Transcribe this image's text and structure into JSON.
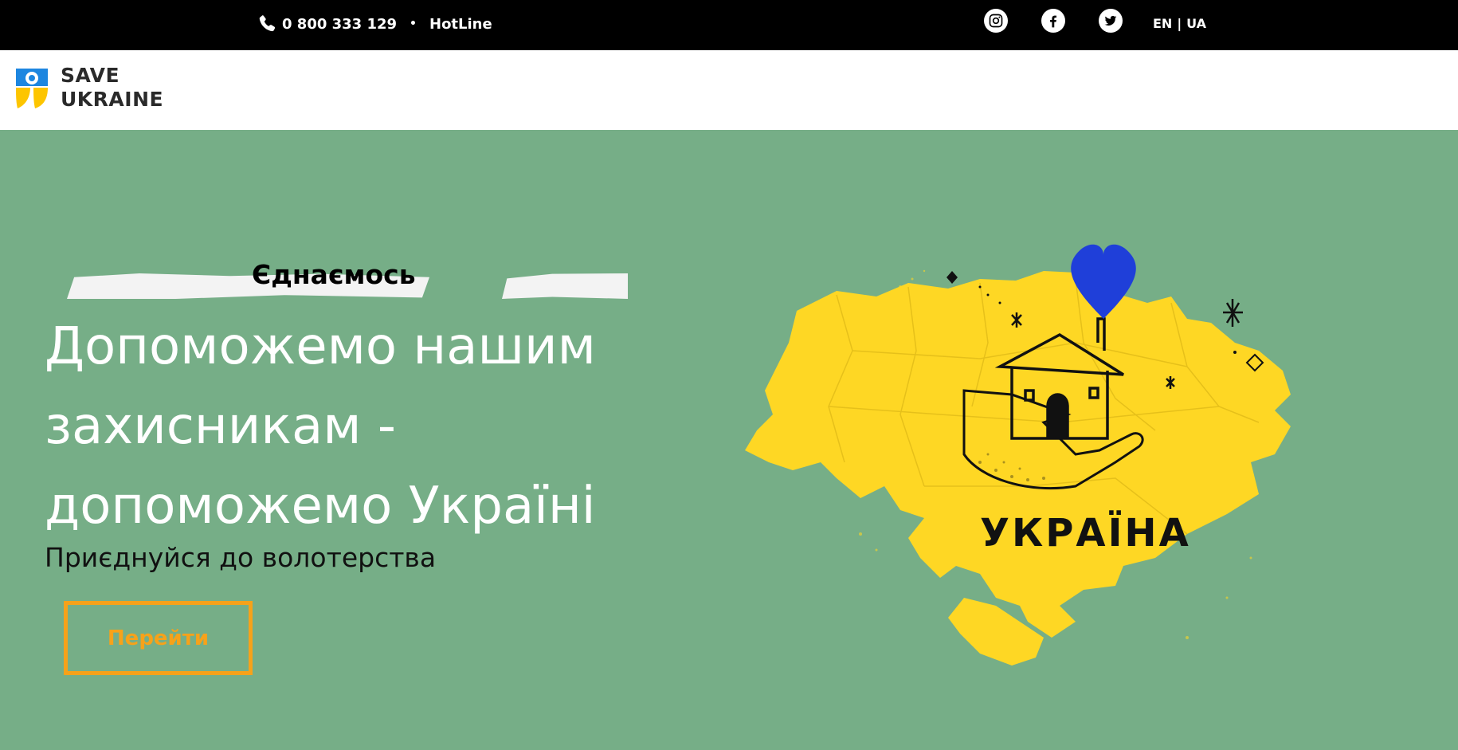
{
  "topbar": {
    "phone_number": "0 800 333 129",
    "separator": "•",
    "hotline_label": "HotLine",
    "socials": [
      {
        "name": "instagram-icon"
      },
      {
        "name": "facebook-icon"
      },
      {
        "name": "twitter-icon"
      }
    ],
    "lang_en": "EN",
    "lang_divider": "|",
    "lang_ua": "UA"
  },
  "header": {
    "logo_line1": "SAVE",
    "logo_line2": "UKRAINE"
  },
  "hero": {
    "unite_label": "Єднаємось",
    "headline_lines": [
      "Допоможемо нашим",
      "захисникам -",
      "допоможемо Україні"
    ],
    "tagline": "Приєднуйся до волотерства",
    "button_label": "Перейти",
    "map_label": "УКРАЇНА"
  },
  "colors": {
    "background": "#76ae87",
    "accent": "#f6a21a",
    "map_yellow": "#fed724",
    "heart_blue": "#1f3fd9"
  }
}
